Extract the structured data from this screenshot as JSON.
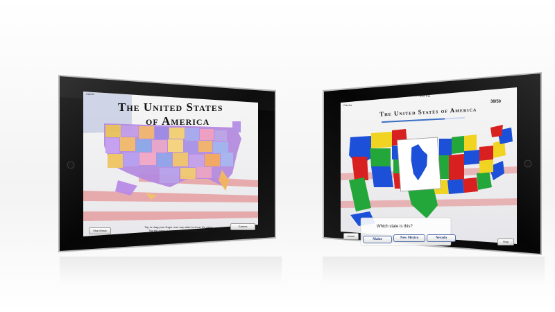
{
  "left_app": {
    "carrier": "Carrier",
    "time": "9:50 PM",
    "title_line1": "The United States",
    "title_line2": "of America",
    "music_button": "Stop Music",
    "games_button": "Games",
    "hint_line1": "Tap or drag your finger over any state to show it's name.",
    "hint_line2": "Tap the name to learn more facts about the state."
  },
  "right_app": {
    "carrier": "Carrier",
    "time": "9:57 PM",
    "title": "The United States of America",
    "score": "38/50",
    "question": "Which state is this?",
    "answers": [
      "Maine",
      "New Mexico",
      "Nevada"
    ],
    "home_button": "Home",
    "stop_button": "Stop",
    "progress": 0.76,
    "accent": "#3a6fc4"
  }
}
